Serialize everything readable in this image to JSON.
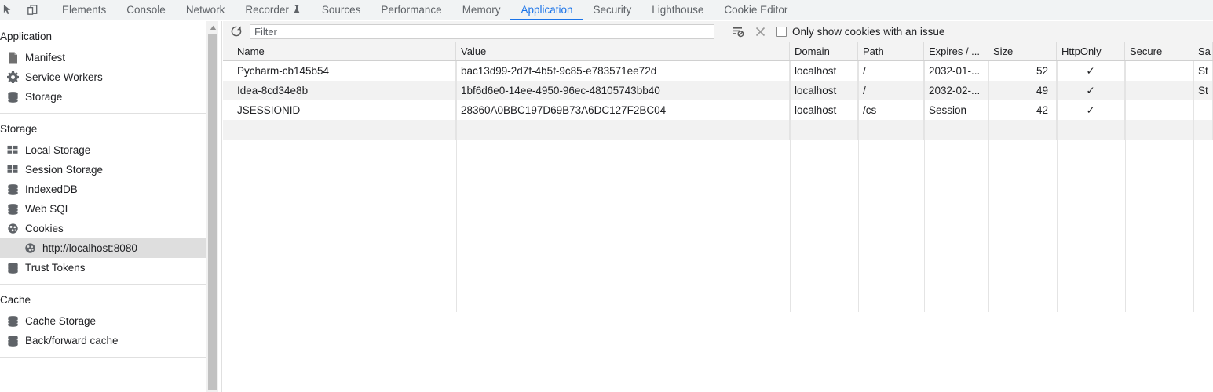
{
  "devtools": {
    "left_icons": [
      {
        "name": "inspect-element-icon",
        "glyph": "inspect"
      },
      {
        "name": "device-toolbar-icon",
        "glyph": "device"
      }
    ],
    "tabs": [
      {
        "label": "Elements",
        "active": false,
        "icon": null
      },
      {
        "label": "Console",
        "active": false,
        "icon": null
      },
      {
        "label": "Network",
        "active": false,
        "icon": null
      },
      {
        "label": "Recorder",
        "active": false,
        "icon": "experiment-flask-icon"
      },
      {
        "label": "Sources",
        "active": false,
        "icon": null
      },
      {
        "label": "Performance",
        "active": false,
        "icon": null
      },
      {
        "label": "Memory",
        "active": false,
        "icon": null
      },
      {
        "label": "Application",
        "active": true,
        "icon": null
      },
      {
        "label": "Security",
        "active": false,
        "icon": null
      },
      {
        "label": "Lighthouse",
        "active": false,
        "icon": null
      },
      {
        "label": "Cookie Editor",
        "active": false,
        "icon": null
      }
    ],
    "accent_color": "#1a73e8"
  },
  "sidebar": {
    "sections": [
      {
        "title": "Application",
        "items": [
          {
            "label": "Manifest",
            "icon": "document-icon",
            "selected": false,
            "indent": false
          },
          {
            "label": "Service Workers",
            "icon": "gear-icon",
            "selected": false,
            "indent": false
          },
          {
            "label": "Storage",
            "icon": "database-icon",
            "selected": false,
            "indent": false
          }
        ]
      },
      {
        "title": "Storage",
        "items": [
          {
            "label": "Local Storage",
            "icon": "table-icon",
            "selected": false,
            "indent": false
          },
          {
            "label": "Session Storage",
            "icon": "table-icon",
            "selected": false,
            "indent": false
          },
          {
            "label": "IndexedDB",
            "icon": "database-icon",
            "selected": false,
            "indent": false
          },
          {
            "label": "Web SQL",
            "icon": "database-icon",
            "selected": false,
            "indent": false
          },
          {
            "label": "Cookies",
            "icon": "cookie-icon",
            "selected": false,
            "indent": false
          },
          {
            "label": "http://localhost:8080",
            "icon": "cookie-icon",
            "selected": true,
            "indent": true
          },
          {
            "label": "Trust Tokens",
            "icon": "database-icon",
            "selected": false,
            "indent": false
          }
        ]
      },
      {
        "title": "Cache",
        "items": [
          {
            "label": "Cache Storage",
            "icon": "database-icon",
            "selected": false,
            "indent": false
          },
          {
            "label": "Back/forward cache",
            "icon": "database-icon",
            "selected": false,
            "indent": false
          }
        ]
      }
    ],
    "selected_highlight_color": "#dedede"
  },
  "toolbar": {
    "refresh_icon": "refresh-icon",
    "filter": {
      "value": "",
      "placeholder": "Filter"
    },
    "clear_filtered_icon": "clear-filtered-cookies-icon",
    "clear_all_icon": "clear-all-cookies-icon",
    "issue_checkbox": {
      "label": "Only show cookies with an issue",
      "checked": false
    }
  },
  "cookie_table": {
    "columns": [
      "Name",
      "Value",
      "Domain",
      "Path",
      "Expires / ...",
      "Size",
      "HttpOnly",
      "Secure",
      "Sa"
    ],
    "rows": [
      {
        "name": "Pycharm-cb145b54",
        "value": "bac13d99-2d7f-4b5f-9c85-e783571ee72d",
        "domain": "localhost",
        "path": "/",
        "expires": "2032-01-...",
        "size": "52",
        "httponly": "✓",
        "secure": "",
        "samesite": "St"
      },
      {
        "name": "Idea-8cd34e8b",
        "value": "1bf6d6e0-14ee-4950-96ec-48105743bb40",
        "domain": "localhost",
        "path": "/",
        "expires": "2032-02-...",
        "size": "49",
        "httponly": "✓",
        "secure": "",
        "samesite": "St"
      },
      {
        "name": "JSESSIONID",
        "value": "28360A0BBC197D69B73A6DC127F2BC04",
        "domain": "localhost",
        "path": "/cs",
        "expires": "Session",
        "size": "42",
        "httponly": "✓",
        "secure": "",
        "samesite": ""
      },
      {
        "name": "",
        "value": "",
        "domain": "",
        "path": "",
        "expires": "",
        "size": "",
        "httponly": "",
        "secure": "",
        "samesite": ""
      }
    ],
    "checkmark_color": "#c2703a",
    "stripe_color": "#f2f2f2"
  }
}
